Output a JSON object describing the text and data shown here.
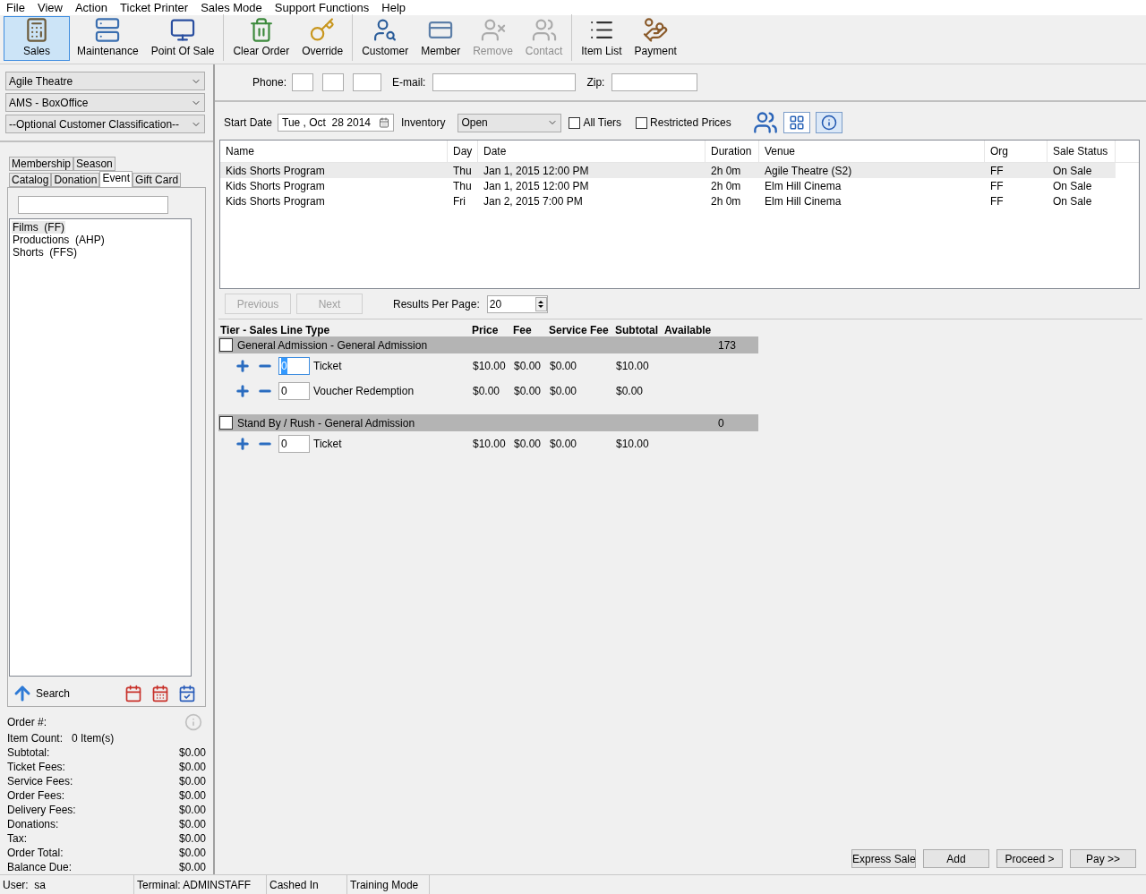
{
  "menu": [
    "File",
    "View",
    "Action",
    "Ticket Printer",
    "Sales Mode",
    "Support Functions",
    "Help"
  ],
  "toolbar": [
    [
      {
        "label": "Sales",
        "selected": true,
        "disabled": false
      },
      {
        "label": "Maintenance",
        "selected": false,
        "disabled": false
      },
      {
        "label": "Point Of Sale",
        "selected": false,
        "disabled": false
      }
    ],
    [
      {
        "label": "Clear Order",
        "selected": false,
        "disabled": false
      },
      {
        "label": "Override",
        "selected": false,
        "disabled": false
      }
    ],
    [
      {
        "label": "Customer",
        "selected": false,
        "disabled": false
      },
      {
        "label": "Member",
        "selected": false,
        "disabled": false
      },
      {
        "label": "Remove",
        "selected": false,
        "disabled": true
      },
      {
        "label": "Contact",
        "selected": false,
        "disabled": true
      }
    ],
    [
      {
        "label": "Item List",
        "selected": false,
        "disabled": false
      },
      {
        "label": "Payment",
        "selected": false,
        "disabled": false
      }
    ]
  ],
  "left": {
    "dropdowns": [
      "Agile Theatre",
      "AMS - BoxOffice",
      "--Optional Customer Classification--"
    ],
    "tab_rows": [
      [
        {
          "label": "Membership",
          "selected": false
        },
        {
          "label": "Season",
          "selected": false
        }
      ],
      [
        {
          "label": "Catalog",
          "selected": false
        },
        {
          "label": "Donation",
          "selected": false
        },
        {
          "label": "Event",
          "selected": true
        },
        {
          "label": "Gift Card",
          "selected": false
        }
      ]
    ],
    "categories": [
      {
        "label": "Films  (FF)",
        "selected": true
      },
      {
        "label": "Productions  (AHP)",
        "selected": false
      },
      {
        "label": "Shorts  (FFS)",
        "selected": false
      }
    ],
    "search_button": "Search",
    "order": {
      "order_label": "Order #:",
      "item_count_label": "Item Count:",
      "item_count": "0 Item(s)",
      "lines": [
        {
          "label": "Subtotal:",
          "value": "$0.00"
        },
        {
          "label": "Ticket Fees:",
          "value": "$0.00"
        },
        {
          "label": "Service Fees:",
          "value": "$0.00"
        },
        {
          "label": "Order Fees:",
          "value": "$0.00"
        },
        {
          "label": "Delivery Fees:",
          "value": "$0.00"
        },
        {
          "label": "Donations:",
          "value": "$0.00"
        },
        {
          "label": "Tax:",
          "value": "$0.00"
        },
        {
          "label": "Order Total:",
          "value": "$0.00"
        },
        {
          "label": "Balance Due:",
          "value": "$0.00"
        }
      ]
    }
  },
  "customer": {
    "phone_label": "Phone:",
    "email_label": "E-mail:",
    "zip_label": "Zip:"
  },
  "filters": {
    "start_date_label": "Start Date",
    "start_date": "Tue , Oct  28 2014",
    "inventory_label": "Inventory",
    "inventory": "Open",
    "checkboxes": [
      {
        "label": "All Tiers",
        "checked": false
      },
      {
        "label": "Restricted Prices",
        "checked": false
      }
    ]
  },
  "events": {
    "columns": [
      "Name",
      "Day",
      "Date",
      "Duration",
      "Venue",
      "Org",
      "Sale Status"
    ],
    "rows": [
      {
        "selected": true,
        "cells": [
          "Kids Shorts Program",
          "Thu",
          "Jan 1, 2015 12:00 PM",
          "2h 0m",
          "Agile Theatre (S2)",
          "FF",
          "On Sale"
        ]
      },
      {
        "selected": false,
        "cells": [
          "Kids Shorts Program",
          "Thu",
          "Jan 1, 2015 12:00 PM",
          "2h 0m",
          "Elm Hill Cinema",
          "FF",
          "On Sale"
        ]
      },
      {
        "selected": false,
        "cells": [
          "Kids Shorts Program",
          "Fri",
          "Jan 2, 2015 7:00 PM",
          "2h 0m",
          "Elm Hill Cinema",
          "FF",
          "On Sale"
        ]
      }
    ]
  },
  "paging": {
    "previous": {
      "label": "Previous",
      "disabled": true
    },
    "next": {
      "label": "Next",
      "disabled": true
    },
    "results_label": "Results Per Page:",
    "results_per_page": "20"
  },
  "tiers": {
    "columns": [
      "Tier - Sales Line Type",
      "Price",
      "Fee",
      "Service Fee",
      "Subtotal",
      "Available"
    ],
    "groups": [
      {
        "name": "General Admission - General Admission",
        "available": "173",
        "checked": false,
        "lines": [
          {
            "qty": "0",
            "focused": true,
            "type": "Ticket",
            "price": "$10.00",
            "fee": "$0.00",
            "service_fee": "$0.00",
            "subtotal": "$10.00"
          },
          {
            "qty": "0",
            "focused": false,
            "type": "Voucher Redemption",
            "price": "$0.00",
            "fee": "$0.00",
            "service_fee": "$0.00",
            "subtotal": "$0.00"
          }
        ]
      },
      {
        "name": "Stand By / Rush - General Admission",
        "available": "0",
        "checked": false,
        "lines": [
          {
            "qty": "0",
            "focused": false,
            "type": "Ticket",
            "price": "$10.00",
            "fee": "$0.00",
            "service_fee": "$0.00",
            "subtotal": "$10.00"
          }
        ]
      }
    ]
  },
  "actions": [
    "Express Sale",
    "Add",
    "Proceed >",
    "Pay >>"
  ],
  "status_bar": [
    "User:  sa",
    "Terminal: ADMINSTAFF",
    "Cashed In",
    "Training Mode"
  ]
}
